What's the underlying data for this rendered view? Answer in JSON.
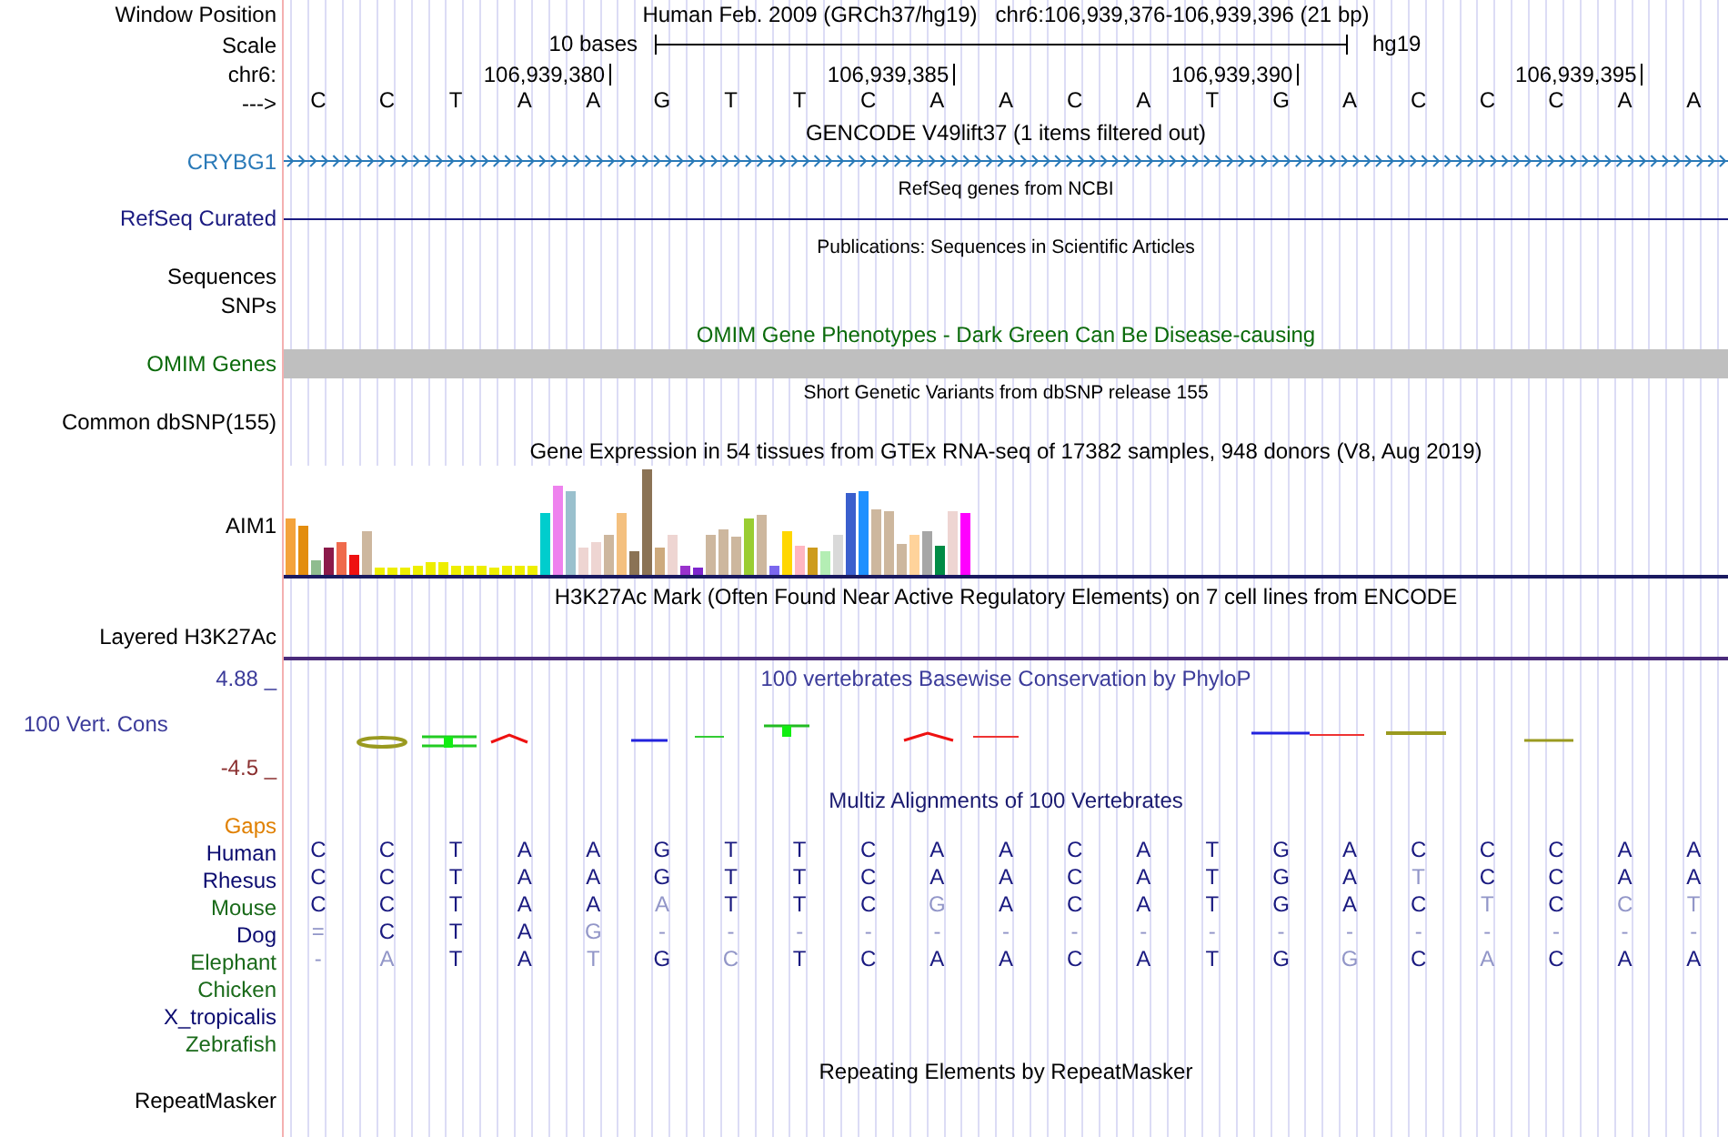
{
  "header": {
    "window_position_label": "Window Position",
    "position": "Human Feb. 2009 (GRCh37/hg19)   chr6:106,939,376-106,939,396 (21 bp)",
    "scale_label": "Scale",
    "scale_length": "10 bases",
    "assembly": "hg19",
    "chrom_label": "chr6:",
    "ticks": [
      "106,939,380",
      "106,939,385",
      "106,939,390",
      "106,939,395"
    ],
    "strand_label": "--->",
    "bases": [
      "C",
      "C",
      "T",
      "A",
      "A",
      "G",
      "T",
      "T",
      "C",
      "A",
      "A",
      "C",
      "A",
      "T",
      "G",
      "A",
      "C",
      "C",
      "C",
      "A",
      "A"
    ]
  },
  "tracks": [
    {
      "kind": "gencode",
      "title": "GENCODE V49lift37 (1 items filtered out)",
      "label": "CRYBG1",
      "color": "#2a7ab8"
    },
    {
      "kind": "refseq",
      "title": "RefSeq genes from NCBI",
      "label": "RefSeq Curated",
      "color": "#1a1a80"
    },
    {
      "kind": "publications",
      "title": "Publications: Sequences in Scientific Articles",
      "label": "Sequences",
      "color": "#000000"
    },
    {
      "kind": "plain",
      "label": "SNPs",
      "color": "#000000"
    },
    {
      "kind": "omim",
      "title": "OMIM Gene Phenotypes - Dark Green Can Be Disease-causing",
      "label": "OMIM Genes",
      "color": "#0a6a0a"
    },
    {
      "kind": "dbsnp",
      "title": "Short Genetic Variants from dbSNP release 155",
      "label": "Common dbSNP(155)",
      "color": "#000000"
    },
    {
      "kind": "gtex",
      "title": "Gene Expression in 54 tissues from GTEx RNA-seq of 17382 samples, 948 donors (V8, Aug 2019)",
      "label": "AIM1",
      "color": "#000000"
    },
    {
      "kind": "h3k27ac",
      "title": "H3K27Ac Mark (Often Found Near Active Regulatory Elements) on 7 cell lines from ENCODE",
      "label": "Layered H3K27Ac",
      "color": "#000000"
    },
    {
      "kind": "phylop",
      "title": "100 vertebrates Basewise Conservation by PhyloP",
      "label": "100 Vert. Cons",
      "color": "#3b3b9a",
      "max_label": "4.88 _",
      "min_label": "-4.5 _"
    },
    {
      "kind": "multiz",
      "title": "Multiz Alignments of 100 Vertebrates",
      "gaps_label": "Gaps",
      "species": [
        {
          "name": "Human",
          "color": "#0b0b70",
          "bases": [
            {
              "b": "C",
              "match": true
            },
            {
              "b": "C",
              "match": true
            },
            {
              "b": "T",
              "match": true
            },
            {
              "b": "A",
              "match": true
            },
            {
              "b": "A",
              "match": true
            },
            {
              "b": "G",
              "match": true
            },
            {
              "b": "T",
              "match": true
            },
            {
              "b": "T",
              "match": true
            },
            {
              "b": "C",
              "match": true
            },
            {
              "b": "A",
              "match": true
            },
            {
              "b": "A",
              "match": true
            },
            {
              "b": "C",
              "match": true
            },
            {
              "b": "A",
              "match": true
            },
            {
              "b": "T",
              "match": true
            },
            {
              "b": "G",
              "match": true
            },
            {
              "b": "A",
              "match": true
            },
            {
              "b": "C",
              "match": true
            },
            {
              "b": "C",
              "match": true
            },
            {
              "b": "C",
              "match": true
            },
            {
              "b": "A",
              "match": true
            },
            {
              "b": "A",
              "match": true
            }
          ]
        },
        {
          "name": "Rhesus",
          "color": "#0b0b70",
          "bases": [
            {
              "b": "C",
              "match": true
            },
            {
              "b": "C",
              "match": true
            },
            {
              "b": "T",
              "match": true
            },
            {
              "b": "A",
              "match": true
            },
            {
              "b": "A",
              "match": true
            },
            {
              "b": "G",
              "match": true
            },
            {
              "b": "T",
              "match": true
            },
            {
              "b": "T",
              "match": true
            },
            {
              "b": "C",
              "match": true
            },
            {
              "b": "A",
              "match": true
            },
            {
              "b": "A",
              "match": true
            },
            {
              "b": "C",
              "match": true
            },
            {
              "b": "A",
              "match": true
            },
            {
              "b": "T",
              "match": true
            },
            {
              "b": "G",
              "match": true
            },
            {
              "b": "A",
              "match": true
            },
            {
              "b": "T",
              "match": false
            },
            {
              "b": "C",
              "match": true
            },
            {
              "b": "C",
              "match": true
            },
            {
              "b": "A",
              "match": true
            },
            {
              "b": "A",
              "match": true
            }
          ]
        },
        {
          "name": "Mouse",
          "color": "#1a6a1a",
          "bases": [
            {
              "b": "C",
              "match": true
            },
            {
              "b": "C",
              "match": true
            },
            {
              "b": "T",
              "match": true
            },
            {
              "b": "A",
              "match": true
            },
            {
              "b": "A",
              "match": true
            },
            {
              "b": "A",
              "match": false
            },
            {
              "b": "T",
              "match": true
            },
            {
              "b": "T",
              "match": true
            },
            {
              "b": "C",
              "match": true
            },
            {
              "b": "G",
              "match": false
            },
            {
              "b": "A",
              "match": true
            },
            {
              "b": "C",
              "match": true
            },
            {
              "b": "A",
              "match": true
            },
            {
              "b": "T",
              "match": true
            },
            {
              "b": "G",
              "match": true
            },
            {
              "b": "A",
              "match": true
            },
            {
              "b": "C",
              "match": true
            },
            {
              "b": "T",
              "match": false
            },
            {
              "b": "C",
              "match": true
            },
            {
              "b": "C",
              "match": false
            },
            {
              "b": "T",
              "match": false
            }
          ]
        },
        {
          "name": "Dog",
          "color": "#0b0b70",
          "bases": [
            {
              "b": "=",
              "match": false
            },
            {
              "b": "C",
              "match": true
            },
            {
              "b": "T",
              "match": true
            },
            {
              "b": "A",
              "match": true
            },
            {
              "b": "G",
              "match": false
            },
            {
              "b": "-",
              "match": false
            },
            {
              "b": "-",
              "match": false
            },
            {
              "b": "-",
              "match": false
            },
            {
              "b": "-",
              "match": false
            },
            {
              "b": "-",
              "match": false
            },
            {
              "b": "-",
              "match": false
            },
            {
              "b": "-",
              "match": false
            },
            {
              "b": "-",
              "match": false
            },
            {
              "b": "-",
              "match": false
            },
            {
              "b": "-",
              "match": false
            },
            {
              "b": "-",
              "match": false
            },
            {
              "b": "-",
              "match": false
            },
            {
              "b": "-",
              "match": false
            },
            {
              "b": "-",
              "match": false
            },
            {
              "b": "-",
              "match": false
            },
            {
              "b": "-",
              "match": false
            }
          ]
        },
        {
          "name": "Elephant",
          "color": "#1a6a1a",
          "bases": [
            {
              "b": "-",
              "match": false
            },
            {
              "b": "A",
              "match": false
            },
            {
              "b": "T",
              "match": true
            },
            {
              "b": "A",
              "match": true
            },
            {
              "b": "T",
              "match": false
            },
            {
              "b": "G",
              "match": true
            },
            {
              "b": "C",
              "match": false
            },
            {
              "b": "T",
              "match": true
            },
            {
              "b": "C",
              "match": true
            },
            {
              "b": "A",
              "match": true
            },
            {
              "b": "A",
              "match": true
            },
            {
              "b": "C",
              "match": true
            },
            {
              "b": "A",
              "match": true
            },
            {
              "b": "T",
              "match": true
            },
            {
              "b": "G",
              "match": true
            },
            {
              "b": "G",
              "match": false
            },
            {
              "b": "C",
              "match": true
            },
            {
              "b": "A",
              "match": false
            },
            {
              "b": "C",
              "match": true
            },
            {
              "b": "A",
              "match": true
            },
            {
              "b": "A",
              "match": true
            }
          ]
        },
        {
          "name": "Chicken",
          "color": "#1a6a1a"
        },
        {
          "name": "X_tropicalis",
          "color": "#0b0b70"
        },
        {
          "name": "Zebrafish",
          "color": "#1a6a1a"
        }
      ]
    },
    {
      "kind": "repeatmasker",
      "title": "Repeating Elements by RepeatMasker",
      "label": "RepeatMasker",
      "color": "#000000"
    }
  ]
}
